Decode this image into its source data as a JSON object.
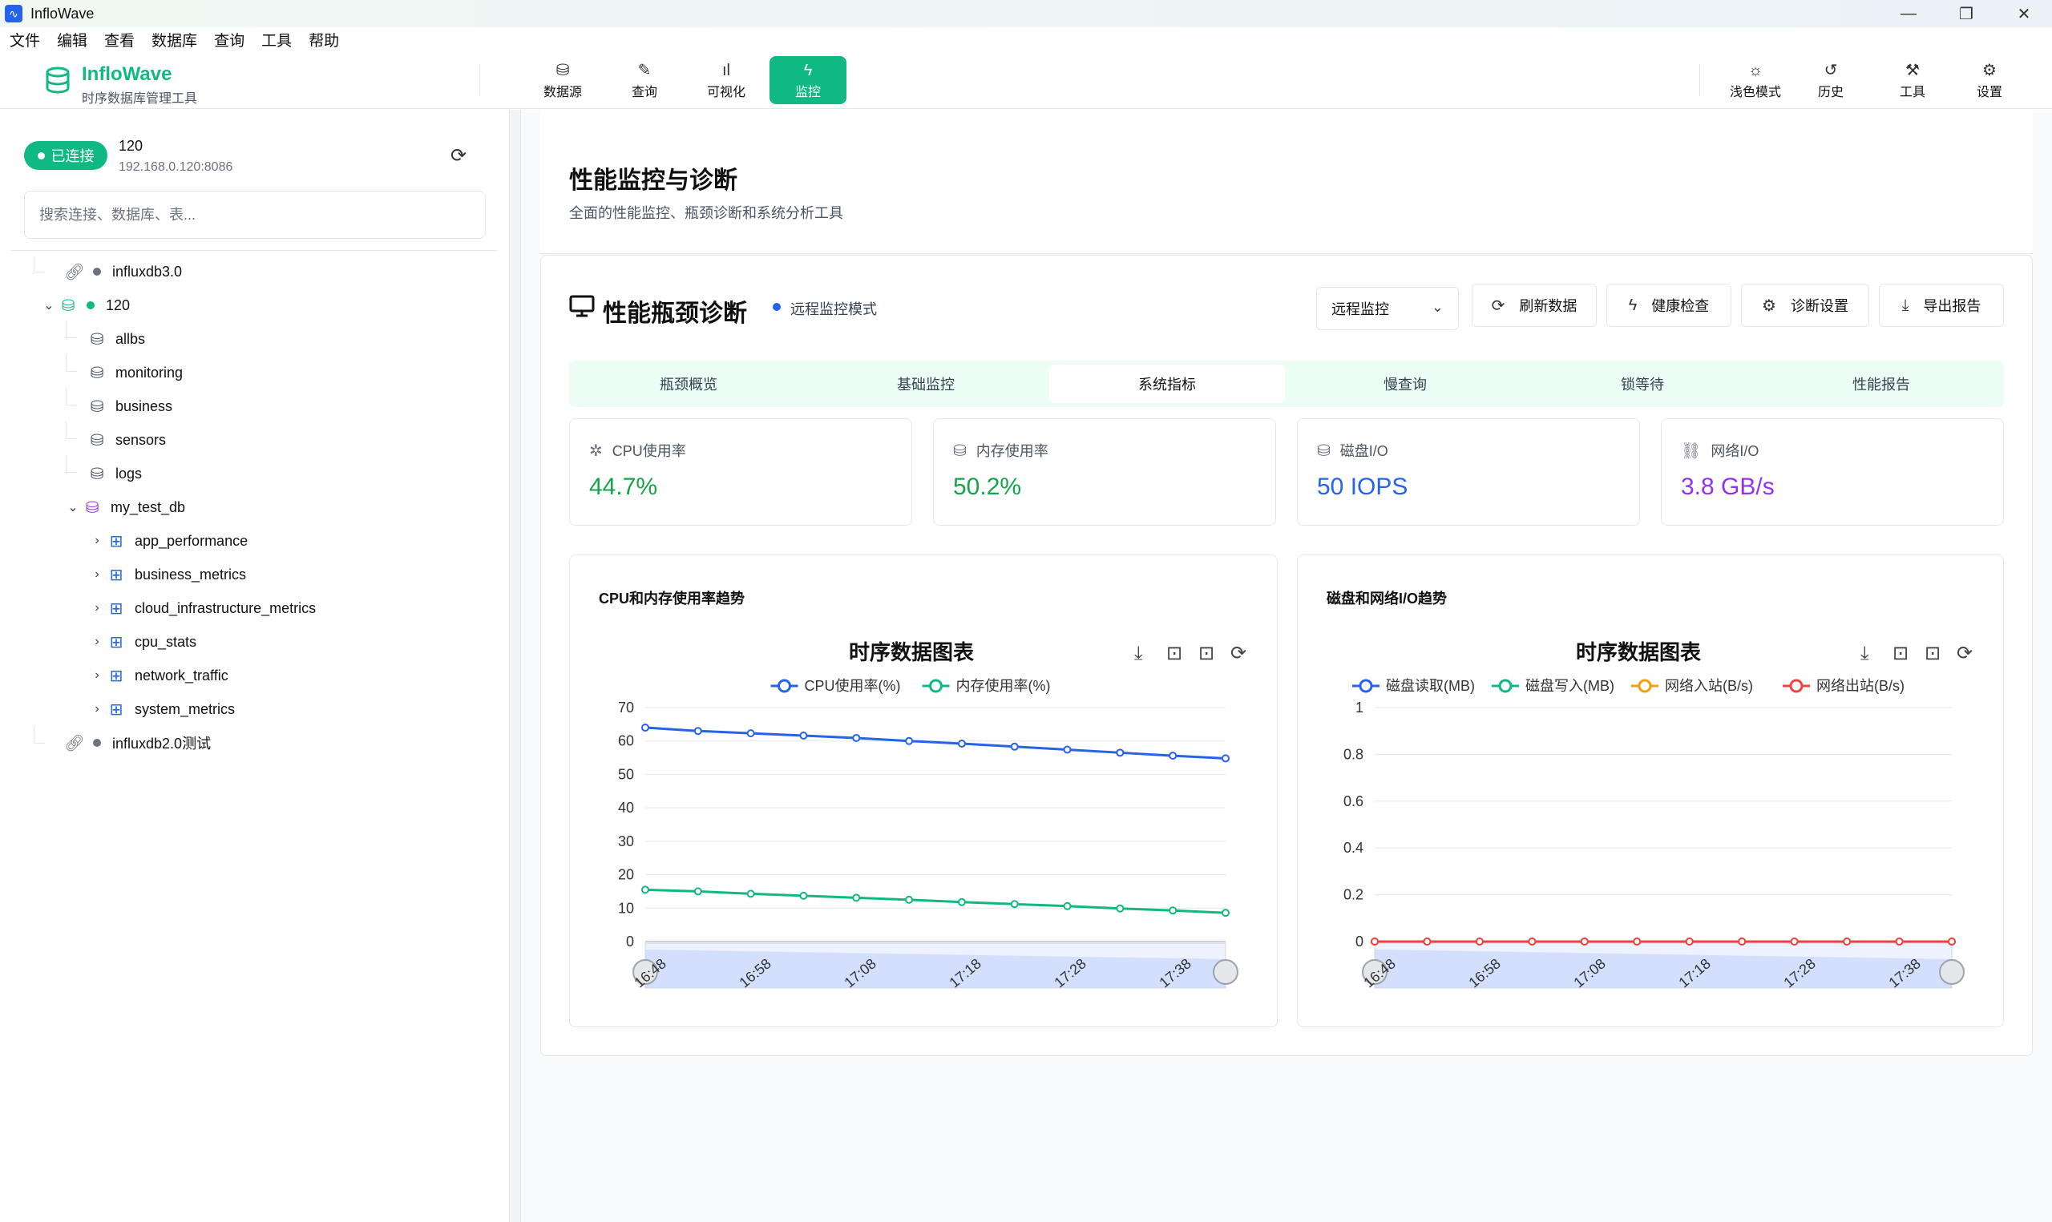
{
  "window": {
    "title": "InfloWave",
    "app_icon": "pulse-icon"
  },
  "menu": [
    "文件",
    "编辑",
    "查看",
    "数据库",
    "查询",
    "工具",
    "帮助"
  ],
  "brand": {
    "name": "InfloWave",
    "subtitle": "时序数据库管理工具"
  },
  "nav": [
    {
      "label": "数据源",
      "icon": "database-icon",
      "active": false
    },
    {
      "label": "查询",
      "icon": "edit-icon",
      "active": false
    },
    {
      "label": "可视化",
      "icon": "bar-chart-icon",
      "active": false
    },
    {
      "label": "监控",
      "icon": "lightning-icon",
      "active": true
    }
  ],
  "nav_right": [
    {
      "label": "浅色模式",
      "icon": "sun-icon"
    },
    {
      "label": "历史",
      "icon": "history-icon"
    },
    {
      "label": "工具",
      "icon": "wrench-icon"
    },
    {
      "label": "设置",
      "icon": "gear-icon"
    }
  ],
  "sidebar": {
    "status": "已连接",
    "connection_name": "120",
    "connection_host": "192.168.0.120:8086",
    "search_placeholder": "搜索连接、数据库、表...",
    "tree": {
      "conn1": "influxdb3.0",
      "conn2": "120",
      "databases": [
        "allbs",
        "monitoring",
        "business",
        "sensors",
        "logs",
        "my_test_db"
      ],
      "tables": [
        "app_performance",
        "business_metrics",
        "cloud_infrastructure_metrics",
        "cpu_stats",
        "network_traffic",
        "system_metrics"
      ],
      "conn3": "influxdb2.0测试"
    }
  },
  "page": {
    "title": "性能监控与诊断",
    "subtitle": "全面的性能监控、瓶颈诊断和系统分析工具"
  },
  "panel": {
    "title": "性能瓶颈诊断",
    "mode": "远程监控模式",
    "select_value": "远程监控",
    "buttons": [
      "刷新数据",
      "健康检查",
      "诊断设置",
      "导出报告"
    ]
  },
  "tabs": [
    "瓶颈概览",
    "基础监控",
    "系统指标",
    "慢查询",
    "锁等待",
    "性能报告"
  ],
  "active_tab": "系统指标",
  "metrics": [
    {
      "label": "CPU使用率",
      "value": "44.7%",
      "color": "#16a34a",
      "icon": "cpu-icon"
    },
    {
      "label": "内存使用率",
      "value": "50.2%",
      "color": "#16a34a",
      "icon": "memory-icon"
    },
    {
      "label": "磁盘I/O",
      "value": "50 IOPS",
      "color": "#2563eb",
      "icon": "disk-icon"
    },
    {
      "label": "网络I/O",
      "value": "3.8 GB/s",
      "color": "#9333ea",
      "icon": "network-icon"
    }
  ],
  "cards": {
    "left_title": "CPU和内存使用率趋势",
    "right_title": "磁盘和网络I/O趋势"
  },
  "chart_data": [
    {
      "type": "line",
      "title": "时序数据图表",
      "x": [
        "16:48",
        "16:58",
        "17:08",
        "17:18",
        "17:28",
        "17:38"
      ],
      "ylim": [
        0,
        70
      ],
      "yticks": [
        0,
        10,
        20,
        30,
        40,
        50,
        60,
        70
      ],
      "series": [
        {
          "name": "CPU使用率(%)",
          "color": "#2563eb",
          "values": [
            64,
            63,
            62.3,
            61.6,
            60.9,
            60,
            59.2,
            58.3,
            57.4,
            56.5,
            55.6,
            54.8
          ]
        },
        {
          "name": "内存使用率(%)",
          "color": "#10b981",
          "values": [
            15.5,
            15,
            14.3,
            13.7,
            13.1,
            12.5,
            11.8,
            11.2,
            10.6,
            9.9,
            9.3,
            8.6
          ]
        }
      ],
      "legend": "top-center",
      "grid": true
    },
    {
      "type": "line",
      "title": "时序数据图表",
      "x": [
        "16:48",
        "16:58",
        "17:08",
        "17:18",
        "17:28",
        "17:38"
      ],
      "ylim": [
        0,
        1
      ],
      "yticks": [
        0,
        0.2,
        0.4,
        0.6,
        0.8,
        1
      ],
      "series": [
        {
          "name": "磁盘读取(MB)",
          "color": "#2563eb",
          "values": [
            0,
            0,
            0,
            0,
            0,
            0,
            0,
            0,
            0,
            0,
            0,
            0
          ]
        },
        {
          "name": "磁盘写入(MB)",
          "color": "#10b981",
          "values": [
            0,
            0,
            0,
            0,
            0,
            0,
            0,
            0,
            0,
            0,
            0,
            0
          ]
        },
        {
          "name": "网络入站(B/s)",
          "color": "#f59e0b",
          "values": [
            0,
            0,
            0,
            0,
            0,
            0,
            0,
            0,
            0,
            0,
            0,
            0
          ]
        },
        {
          "name": "网络出站(B/s)",
          "color": "#ef4444",
          "values": [
            0,
            0,
            0,
            0,
            0,
            0,
            0,
            0,
            0,
            0,
            0,
            0
          ]
        }
      ],
      "legend": "top-center",
      "grid": true
    }
  ]
}
